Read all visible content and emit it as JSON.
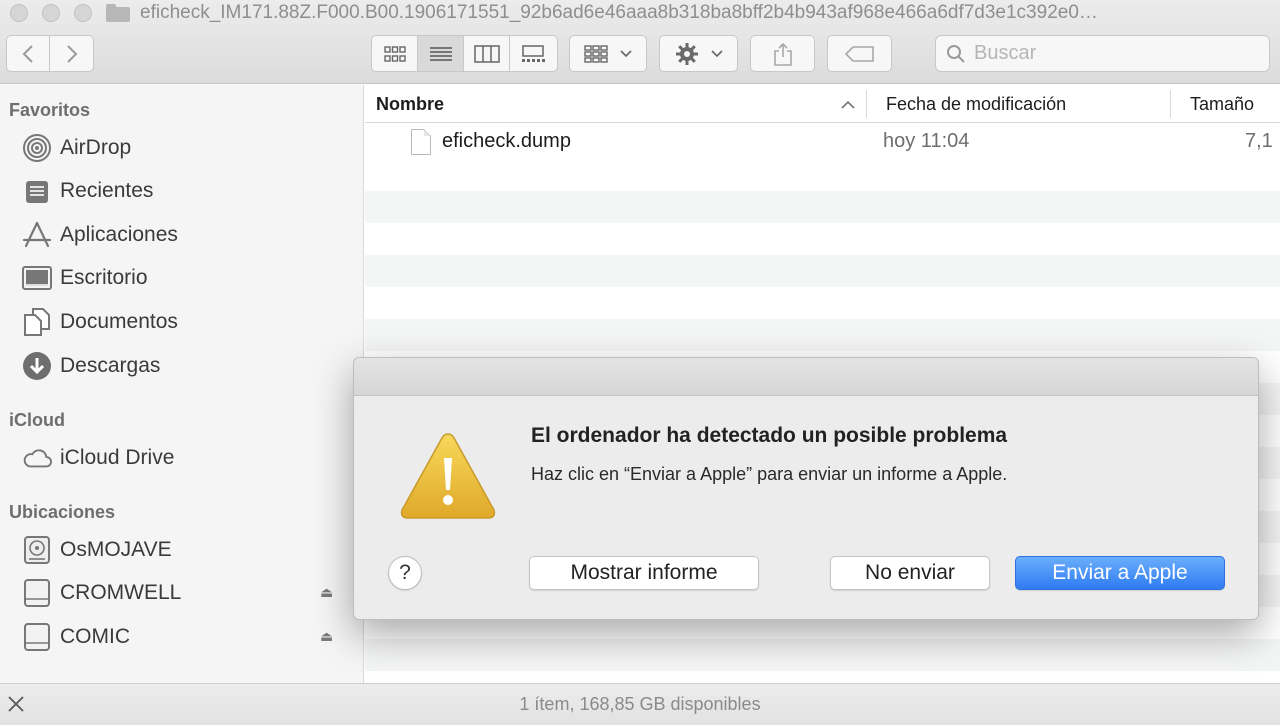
{
  "window": {
    "title": "eficheck_IM171.88Z.F000.B00.1906171551_92b6ad6e46aaa8b318ba8bff2b4b943af968e466a6df7d3e1c392e0…"
  },
  "toolbar": {
    "search_placeholder": "Buscar"
  },
  "sidebar": {
    "favorites_header": "Favoritos",
    "favorites": [
      {
        "label": "AirDrop",
        "icon": "airdrop-icon"
      },
      {
        "label": "Recientes",
        "icon": "recents-icon"
      },
      {
        "label": "Aplicaciones",
        "icon": "applications-icon"
      },
      {
        "label": "Escritorio",
        "icon": "desktop-icon"
      },
      {
        "label": "Documentos",
        "icon": "documents-icon"
      },
      {
        "label": "Descargas",
        "icon": "downloads-icon"
      }
    ],
    "icloud_header": "iCloud",
    "icloud": [
      {
        "label": "iCloud Drive",
        "icon": "cloud-icon"
      }
    ],
    "locations_header": "Ubicaciones",
    "locations": [
      {
        "label": "OsMOJAVE",
        "icon": "internal-disk-icon"
      },
      {
        "label": "CROMWELL",
        "icon": "external-disk-icon",
        "eject": true
      },
      {
        "label": "COMIC",
        "icon": "external-disk-icon",
        "eject": true
      }
    ]
  },
  "list": {
    "columns": [
      "Nombre",
      "Fecha de modificación",
      "Tamaño"
    ],
    "rows": [
      {
        "name": "eficheck.dump",
        "modified": "hoy 11:04",
        "size": "7,1"
      }
    ]
  },
  "status": {
    "text": "1 ítem, 168,85 GB disponibles"
  },
  "dialog": {
    "title": "El ordenador ha detectado un posible problema",
    "message": "Haz clic en “Enviar a Apple” para enviar un informe a Apple.",
    "help_label": "?",
    "show_report_label": "Mostrar informe",
    "dont_send_label": "No enviar",
    "send_label": "Enviar a Apple"
  }
}
